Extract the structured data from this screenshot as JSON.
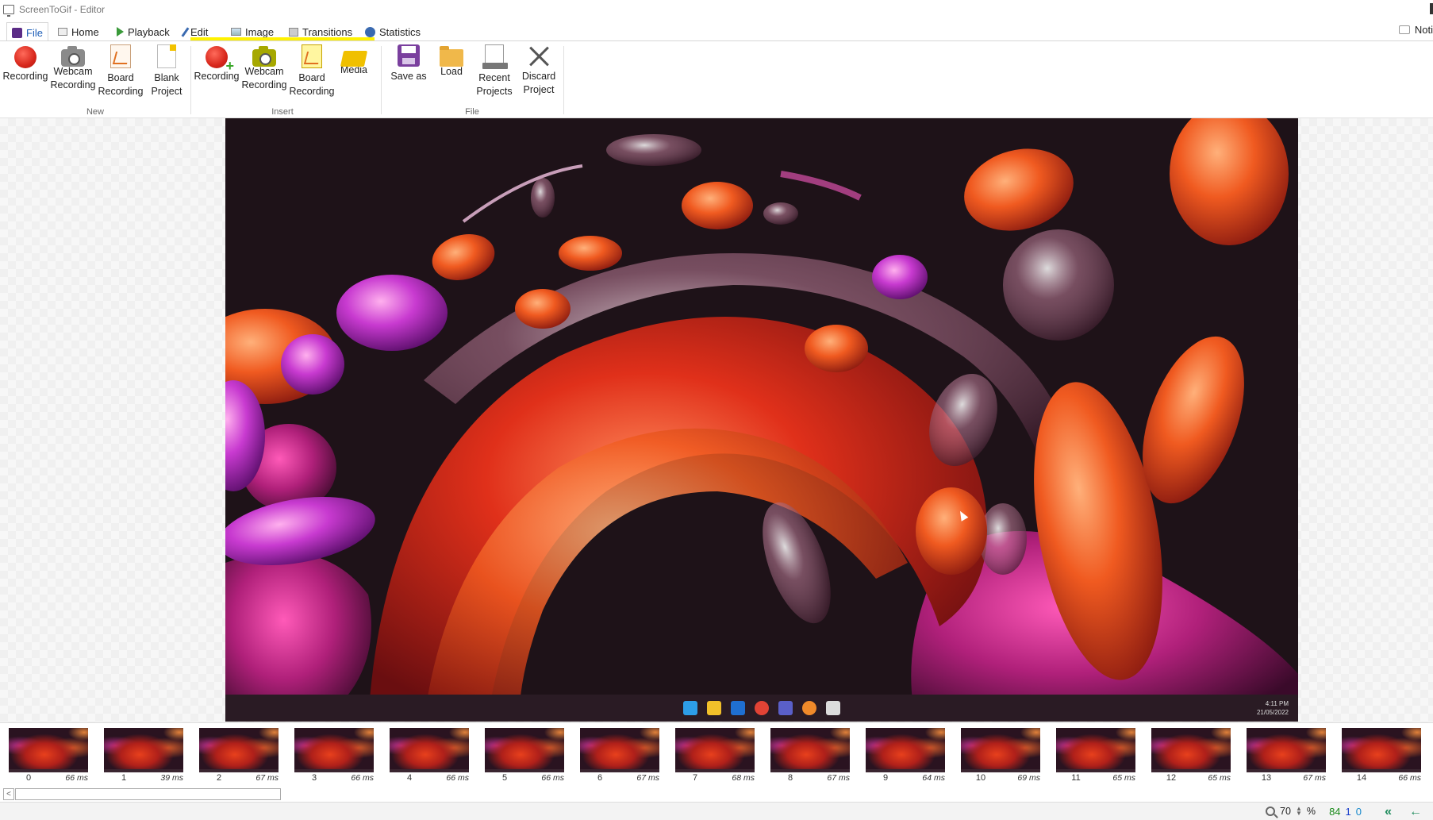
{
  "window": {
    "title": "ScreenToGif - Editor",
    "notifications_label": "Noti"
  },
  "tabs": [
    {
      "label": "File",
      "icon": "save-icon",
      "active": true
    },
    {
      "label": "Home",
      "icon": "home-icon"
    },
    {
      "label": "Playback",
      "icon": "play-icon"
    },
    {
      "label": "Edit",
      "icon": "pencil-icon"
    },
    {
      "label": "Image",
      "icon": "image-icon"
    },
    {
      "label": "Transitions",
      "icon": "transitions-icon"
    },
    {
      "label": "Statistics",
      "icon": "info-icon"
    }
  ],
  "ribbon": {
    "groups": {
      "new": {
        "label": "New",
        "items": [
          {
            "label": "Recording",
            "icon": "record-icon"
          },
          {
            "label": "Webcam Recording",
            "icon": "webcam-icon"
          },
          {
            "label": "Board Recording",
            "icon": "board-icon"
          },
          {
            "label": "Blank Project",
            "icon": "blank-project-icon"
          }
        ]
      },
      "insert": {
        "label": "Insert",
        "highlight_color": "#fff200",
        "items": [
          {
            "label": "Recording",
            "icon": "record-insert-icon"
          },
          {
            "label": "Webcam Recording",
            "icon": "webcam-insert-icon"
          },
          {
            "label": "Board Recording",
            "icon": "board-insert-icon"
          },
          {
            "label": "Media",
            "icon": "media-icon"
          }
        ]
      },
      "file": {
        "label": "File",
        "items": [
          {
            "label": "Save as",
            "icon": "save-as-icon"
          },
          {
            "label": "Load",
            "icon": "folder-icon"
          },
          {
            "label": "Recent Projects",
            "icon": "recent-projects-icon"
          },
          {
            "label": "Discard Project",
            "icon": "discard-icon"
          }
        ]
      }
    }
  },
  "preview": {
    "clock_time": "4:11 PM",
    "clock_date": "21/05/2022"
  },
  "frames": [
    {
      "index": "0",
      "delay": "66 ms"
    },
    {
      "index": "1",
      "delay": "39 ms"
    },
    {
      "index": "2",
      "delay": "67 ms"
    },
    {
      "index": "3",
      "delay": "66 ms"
    },
    {
      "index": "4",
      "delay": "66 ms"
    },
    {
      "index": "5",
      "delay": "66 ms"
    },
    {
      "index": "6",
      "delay": "67 ms"
    },
    {
      "index": "7",
      "delay": "68 ms"
    },
    {
      "index": "8",
      "delay": "67 ms"
    },
    {
      "index": "9",
      "delay": "64 ms"
    },
    {
      "index": "10",
      "delay": "69 ms"
    },
    {
      "index": "11",
      "delay": "65 ms"
    },
    {
      "index": "12",
      "delay": "65 ms"
    },
    {
      "index": "13",
      "delay": "67 ms"
    },
    {
      "index": "14",
      "delay": "66 ms"
    }
  ],
  "status": {
    "zoom_value": "70",
    "zoom_unit": "%",
    "frame_count": "84",
    "selected_count": "1",
    "current_frame": "0"
  }
}
